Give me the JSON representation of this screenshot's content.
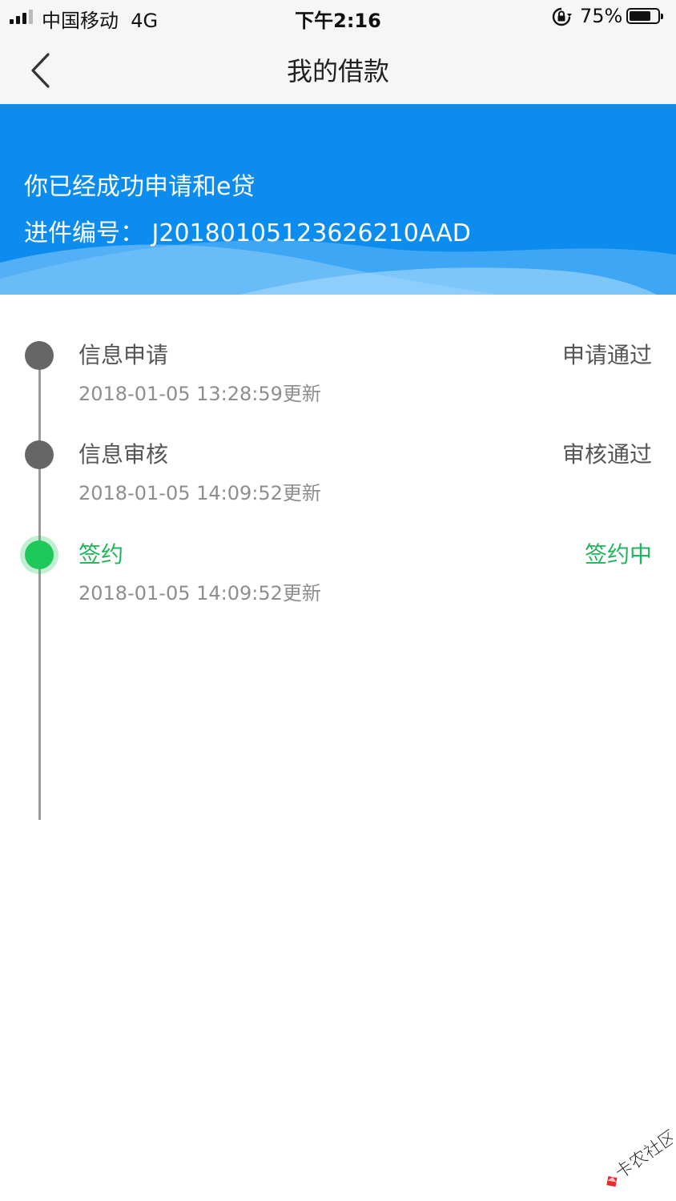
{
  "status_bar": {
    "carrier": "中国移动",
    "network": "4G",
    "time": "下午2:16",
    "battery_percent": "75%",
    "battery_level": 0.75,
    "icons": [
      "signal-icon",
      "rotation-lock-icon",
      "battery-icon"
    ]
  },
  "nav": {
    "title": "我的借款",
    "back_icon": "chevron-left-icon"
  },
  "banner": {
    "message": "你已经成功申请和e贷",
    "application_id": "进件编号：  J20180105123626210AAD",
    "color": "#0d8cf0"
  },
  "timeline": {
    "steps": [
      {
        "name": "信息申请",
        "status": "申请通过",
        "time": "2018-01-05 13:28:59更新",
        "active": false
      },
      {
        "name": "信息审核",
        "status": "审核通过",
        "time": "2018-01-05 14:09:52更新",
        "active": false
      },
      {
        "name": "签约",
        "status": "签约中",
        "time": "2018-01-05 14:09:52更新",
        "active": true
      }
    ],
    "active_color": "#1fb65a"
  },
  "watermark": {
    "text": "卡农社区"
  }
}
